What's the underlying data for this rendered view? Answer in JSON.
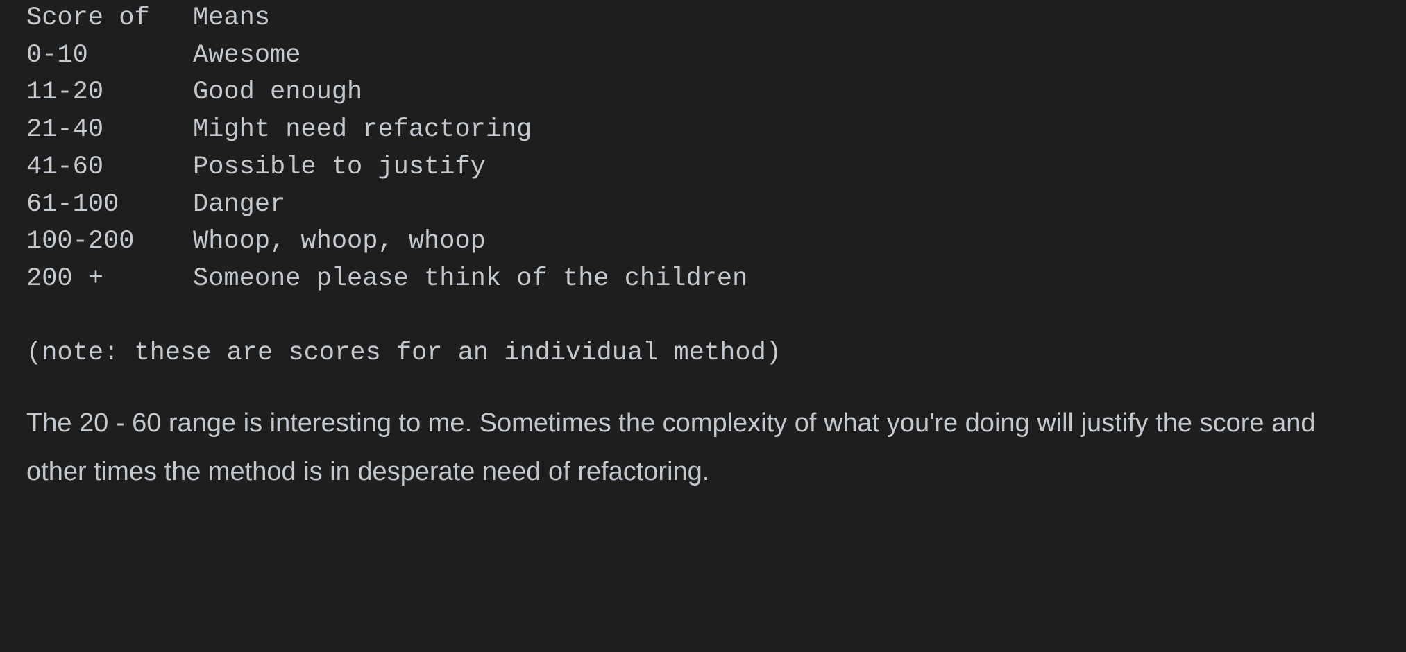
{
  "theme": {
    "background": "#1e1e1e",
    "text_color": "#c3c9ce"
  },
  "code_block": {
    "table": {
      "headers": {
        "score": "Score of",
        "means": "Means"
      },
      "rows": [
        {
          "score": "0-10",
          "means": "Awesome"
        },
        {
          "score": "11-20",
          "means": "Good enough"
        },
        {
          "score": "21-40",
          "means": "Might need refactoring"
        },
        {
          "score": "41-60",
          "means": "Possible to justify"
        },
        {
          "score": "61-100",
          "means": "Danger"
        },
        {
          "score": "100-200",
          "means": "Whoop, whoop, whoop"
        },
        {
          "score": "200 +",
          "means": "Someone please think of the children"
        }
      ]
    },
    "note": "(note: these are scores for an individual method)"
  },
  "prose": {
    "paragraph": "The 20 - 60 range is interesting to me. Sometimes the complexity of what you're doing will justify the score and other times the method is in desperate need of refactoring."
  }
}
